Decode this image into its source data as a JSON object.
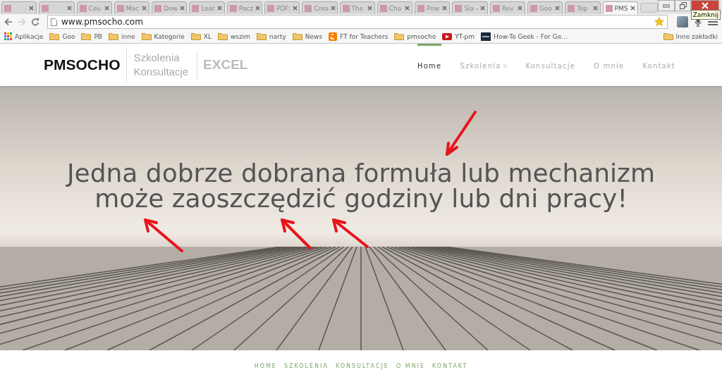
{
  "browser": {
    "tabs": [
      {
        "selected": false
      },
      {
        "selected": false
      },
      {
        "title": "Cou",
        "selected": false
      },
      {
        "title": "Mac",
        "selected": false
      },
      {
        "title": "Dow",
        "selected": false
      },
      {
        "title": "Lear",
        "selected": false
      },
      {
        "title": "Pacz",
        "selected": false
      },
      {
        "title": "PDF:",
        "selected": false
      },
      {
        "title": "Crea",
        "selected": false
      },
      {
        "title": "The",
        "selected": false
      },
      {
        "title": "Cha",
        "selected": false
      },
      {
        "title": "Pow",
        "selected": false
      },
      {
        "title": "Sia -",
        "selected": false
      },
      {
        "title": "Rev",
        "selected": false
      },
      {
        "title": "Goo",
        "selected": false
      },
      {
        "title": "Top",
        "selected": false
      },
      {
        "title": "PMS",
        "selected": true
      }
    ],
    "close_tooltip": "Zamknij",
    "url": "www.pmsocho.com",
    "bookmarks": [
      {
        "label": "Aplikacje",
        "kind": "apps"
      },
      {
        "label": "Goo",
        "kind": "folder"
      },
      {
        "label": "PB",
        "kind": "folder"
      },
      {
        "label": "inne",
        "kind": "folder"
      },
      {
        "label": "Kategorie",
        "kind": "folder"
      },
      {
        "label": "XL",
        "kind": "folder"
      },
      {
        "label": "wszim",
        "kind": "folder"
      },
      {
        "label": "narty",
        "kind": "folder"
      },
      {
        "label": "News",
        "kind": "folder"
      },
      {
        "label": "FT for Teachers",
        "kind": "blogger"
      },
      {
        "label": "pmsocho",
        "kind": "folder"
      },
      {
        "label": "YT-pm",
        "kind": "youtube"
      },
      {
        "label": "How-To Geek - For Ge...",
        "kind": "htg"
      }
    ],
    "other_bookmarks": "Inne zakładki"
  },
  "site": {
    "logo": "PMSOCHO",
    "tagline_1": "Szkolenia",
    "tagline_2": "Konsultacje",
    "logo_excel": "EXCEL",
    "nav": [
      {
        "label": "Home",
        "selected": true,
        "dropdown": false
      },
      {
        "label": "Szkolenia",
        "selected": false,
        "dropdown": true
      },
      {
        "label": "Konsultacje",
        "selected": false,
        "dropdown": false
      },
      {
        "label": "O mnie",
        "selected": false,
        "dropdown": false
      },
      {
        "label": "Kontakt",
        "selected": false,
        "dropdown": false
      }
    ],
    "headline": "Jedna dobrze dobrana formuła lub mechanizm\nmoże zaoszczędzić godziny lub dni pracy!",
    "footer_nav": [
      "HOME",
      "SZKOLENIA",
      "KONSULTACJE",
      "O MNIE",
      "KONTAKT"
    ]
  }
}
